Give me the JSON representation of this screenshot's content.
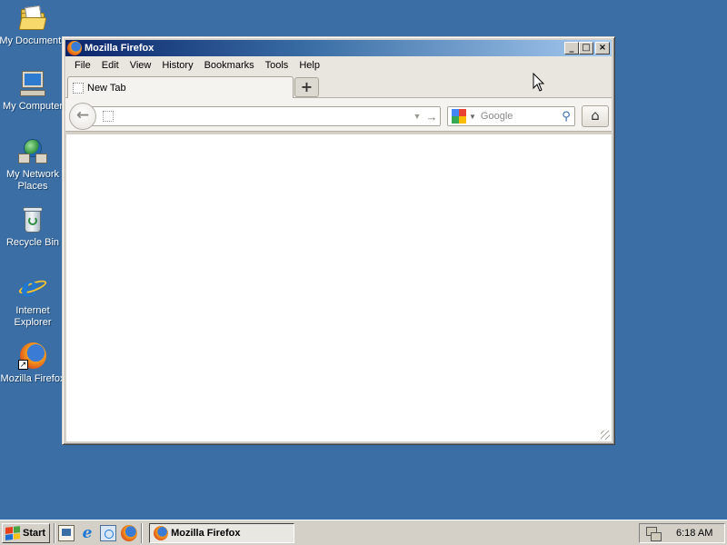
{
  "desktop": {
    "icons": [
      {
        "label": "My Documents",
        "icon": "my-documents-icon"
      },
      {
        "label": "My Computer",
        "icon": "my-computer-icon"
      },
      {
        "label": "My Network Places",
        "icon": "network-places-icon"
      },
      {
        "label": "Recycle Bin",
        "icon": "recycle-bin-icon"
      },
      {
        "label": "Internet Explorer",
        "icon": "internet-explorer-icon"
      },
      {
        "label": "Mozilla Firefox",
        "icon": "firefox-icon"
      }
    ]
  },
  "window": {
    "title": "Mozilla Firefox",
    "caption_buttons": {
      "minimize": "_",
      "maximize": "□",
      "close": "×"
    }
  },
  "menubar": {
    "items": [
      "File",
      "Edit",
      "View",
      "History",
      "Bookmarks",
      "Tools",
      "Help"
    ]
  },
  "tabs": {
    "items": [
      {
        "label": "New Tab"
      }
    ],
    "new_tab_label": "+"
  },
  "navbar": {
    "back_glyph": "←",
    "url_value": "",
    "dropmarker_glyph": "▼",
    "go_glyph": "→",
    "search_placeholder": "Google",
    "search_engine": "Google",
    "search_glyph": "⚲",
    "home_glyph": "⌂"
  },
  "taskbar": {
    "start_label": "Start",
    "quick_launch": [
      "show-desktop-icon",
      "internet-explorer-icon",
      "network-icon",
      "firefox-icon"
    ],
    "tasks": [
      {
        "label": "Mozilla Firefox",
        "active": true
      }
    ],
    "clock": "6:18 AM"
  },
  "colors": {
    "desktop": "#3a6ea5",
    "titlebar_start": "#0a246a",
    "titlebar_end": "#a6caf0",
    "chrome": "#d4d0c8"
  }
}
